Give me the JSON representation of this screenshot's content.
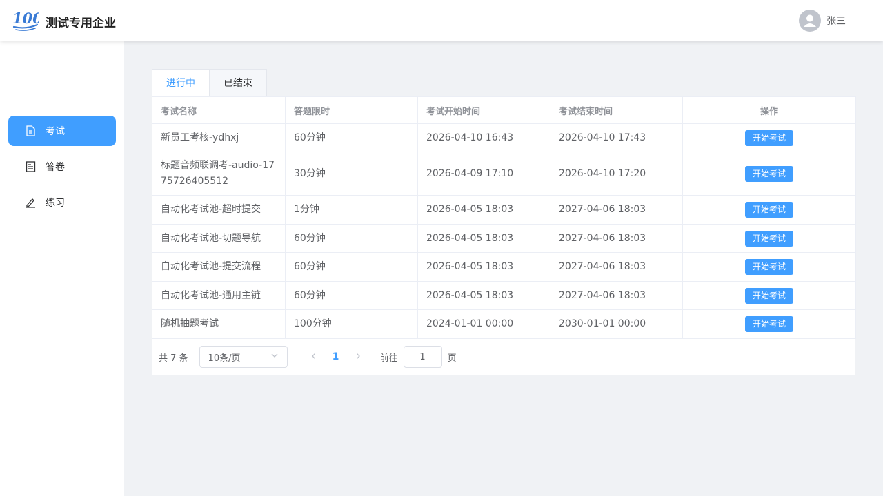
{
  "header": {
    "company": "测试专用企业",
    "username": "张三"
  },
  "sidebar": {
    "items": [
      {
        "label": "考试",
        "icon": "document-icon",
        "active": true
      },
      {
        "label": "答卷",
        "icon": "answer-sheet-icon",
        "active": false
      },
      {
        "label": "练习",
        "icon": "pencil-icon",
        "active": false
      }
    ]
  },
  "tabs": [
    "进行中",
    "已结束"
  ],
  "table": {
    "columns": [
      "考试名称",
      "答题限时",
      "考试开始时间",
      "考试结束时间",
      "操作"
    ],
    "rows": [
      {
        "name": "新员工考核-ydhxj",
        "limit": "60分钟",
        "start": "2026-04-10 16:43",
        "end": "2026-04-10 17:43",
        "action": "开始考试"
      },
      {
        "name": "标题音频联调考-audio-1775726405512",
        "limit": "30分钟",
        "start": "2026-04-09 17:10",
        "end": "2026-04-10 17:20",
        "action": "开始考试"
      },
      {
        "name": "自动化考试池-超时提交",
        "limit": "1分钟",
        "start": "2026-04-05 18:03",
        "end": "2027-04-06 18:03",
        "action": "开始考试"
      },
      {
        "name": "自动化考试池-切题导航",
        "limit": "60分钟",
        "start": "2026-04-05 18:03",
        "end": "2027-04-06 18:03",
        "action": "开始考试"
      },
      {
        "name": "自动化考试池-提交流程",
        "limit": "60分钟",
        "start": "2026-04-05 18:03",
        "end": "2027-04-06 18:03",
        "action": "开始考试"
      },
      {
        "name": "自动化考试池-通用主链",
        "limit": "60分钟",
        "start": "2026-04-05 18:03",
        "end": "2027-04-06 18:03",
        "action": "开始考试"
      },
      {
        "name": "随机抽题考试",
        "limit": "100分钟",
        "start": "2024-01-01 00:00",
        "end": "2030-01-01 00:00",
        "action": "开始考试"
      }
    ]
  },
  "pagination": {
    "total": "共 7 条",
    "page_size": "10条/页",
    "current_page": "1",
    "goto_label": "前往",
    "goto_value": "1",
    "page_suffix": "页"
  },
  "colors": {
    "accent": "#409eff",
    "background": "#f0f2f5"
  }
}
